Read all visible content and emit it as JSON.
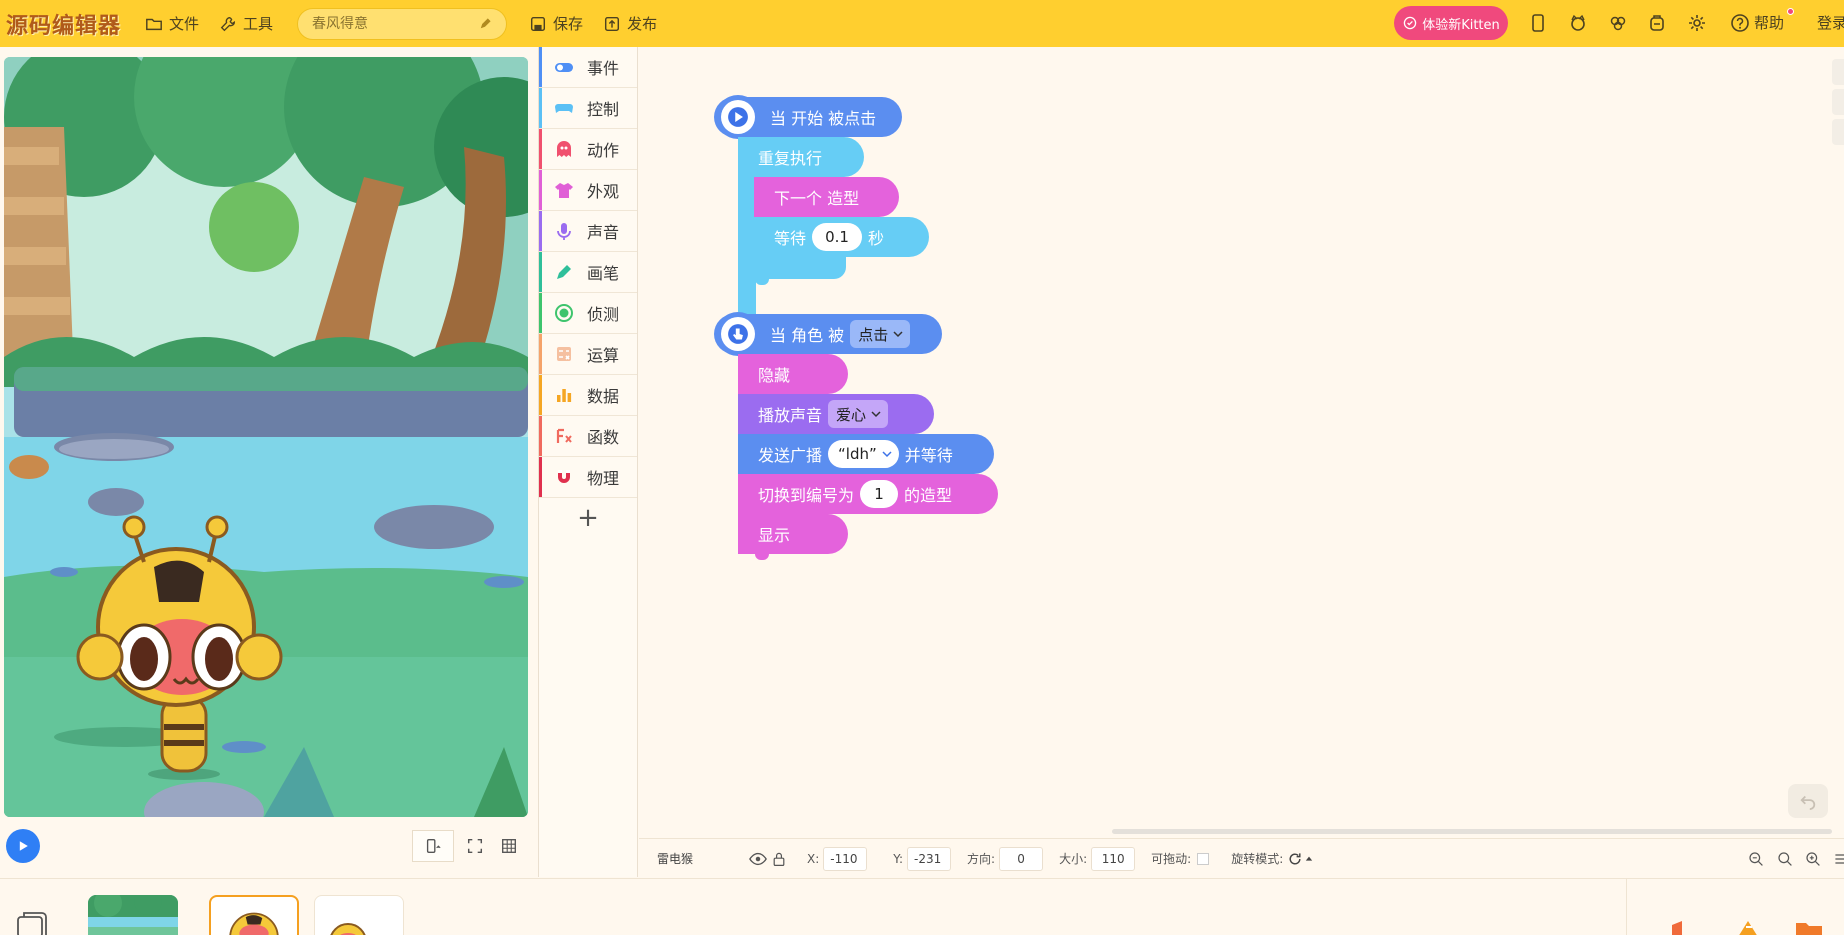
{
  "app": {
    "logo": "源码编辑器",
    "menu": [
      {
        "label": "文件",
        "icon": "folder-icon"
      },
      {
        "label": "工具",
        "icon": "wrench-icon"
      }
    ],
    "project_name_placeholder": "春风得意",
    "actions": [
      {
        "label": "保存",
        "icon": "save-icon"
      },
      {
        "label": "发布",
        "icon": "publish-icon"
      }
    ],
    "try_new_kitten": "体验新Kitten",
    "help": "帮助",
    "login": "登录"
  },
  "categories": [
    {
      "label": "事件",
      "color": "#4f8ff5",
      "icon": "toggle-icon"
    },
    {
      "label": "控制",
      "color": "#5bc0f5",
      "icon": "gamepad-icon"
    },
    {
      "label": "动作",
      "color": "#f0506e",
      "icon": "ghost-icon"
    },
    {
      "label": "外观",
      "color": "#e05fd6",
      "icon": "shirt-icon"
    },
    {
      "label": "声音",
      "color": "#9a6cf0",
      "icon": "microphone-icon"
    },
    {
      "label": "画笔",
      "color": "#2fbf9a",
      "icon": "pen-icon"
    },
    {
      "label": "侦测",
      "color": "#3ec46d",
      "icon": "radar-icon"
    },
    {
      "label": "运算",
      "color": "#f5a36a",
      "icon": "calculator-icon"
    },
    {
      "label": "数据",
      "color": "#f5a623",
      "icon": "bar-chart-icon"
    },
    {
      "label": "函数",
      "color": "#f06a5e",
      "icon": "function-icon"
    },
    {
      "label": "物理",
      "color": "#e0304e",
      "icon": "magnet-icon"
    }
  ],
  "add_category": "+",
  "script1": {
    "hat": "当 开始 被点击",
    "repeat": "重复执行",
    "next_costume": "下一个 造型",
    "wait_prefix": "等待",
    "wait_value": "0.1",
    "wait_suffix": "秒"
  },
  "script2": {
    "hat_prefix": "当 角色 被",
    "hat_dropdown": "点击",
    "hide": "隐藏",
    "play_sound": "播放声音",
    "sound_dropdown": "爱心",
    "broadcast": "发送广播",
    "broadcast_value": "“ldh”",
    "broadcast_suffix": "并等待",
    "switch_costume": "切换到编号为",
    "costume_value": "1",
    "costume_suffix": "的造型",
    "show": "显示"
  },
  "properties": {
    "sprite_name": "雷电猴",
    "x_label": "X:",
    "x_value": "-110",
    "y_label": "Y:",
    "y_value": "-231",
    "direction_label": "方向:",
    "direction_value": "0",
    "size_label": "大小:",
    "size_value": "110",
    "draggable_label": "可拖动:",
    "rotation_label": "旋转模式:"
  }
}
